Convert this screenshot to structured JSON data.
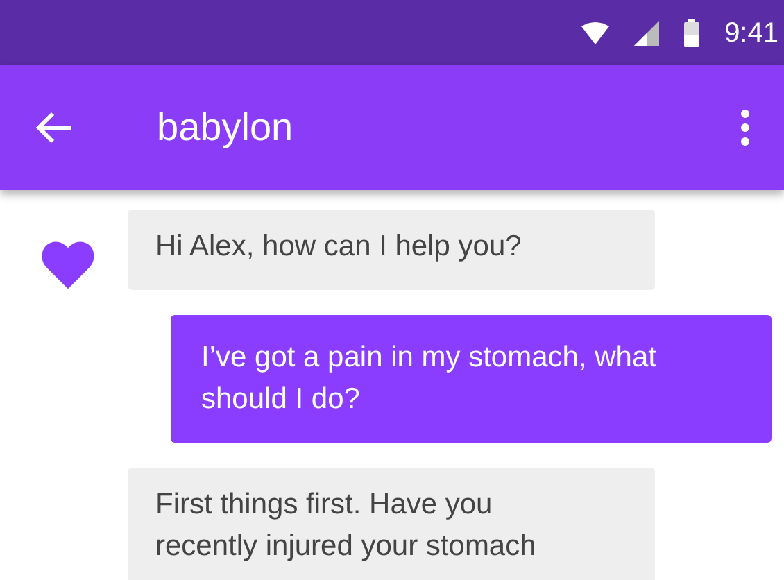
{
  "status_bar": {
    "time": "9:41"
  },
  "app_bar": {
    "title": "babylon"
  },
  "messages": [
    {
      "kind": "bot",
      "show_avatar": true,
      "text": "Hi Alex, how can I help you?"
    },
    {
      "kind": "user",
      "show_avatar": false,
      "text": "I’ve got a pain in my stomach, what\nshould I do?"
    },
    {
      "kind": "bot",
      "show_avatar": false,
      "text": "First things first. Have you\nrecently injured your stomach"
    }
  ]
}
